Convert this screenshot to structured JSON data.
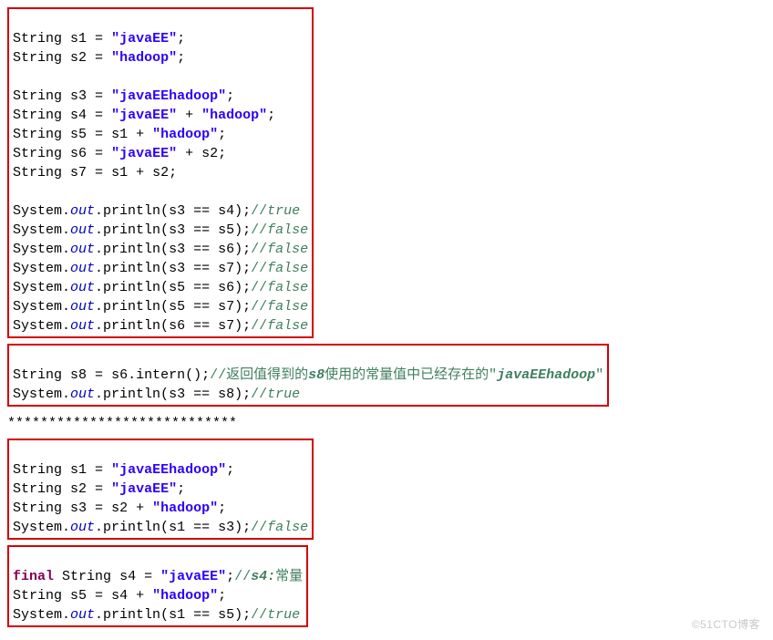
{
  "code": {
    "type": "String",
    "s1": "s1",
    "s2": "s2",
    "s3": "s3",
    "s4": "s4",
    "s5": "s5",
    "s6": "s6",
    "s7": "s7",
    "s8": "s8",
    "eq": " = ",
    "plus": " + ",
    "semi": ";",
    "eqeq": " == ",
    "sys": "System",
    "dot": ".",
    "out": "out",
    "println_open": ".println(",
    "close_paren": ")",
    "intern": ".intern()",
    "final": "final"
  },
  "strings": {
    "javaEE": "\"javaEE\"",
    "hadoop": "\"hadoop\"",
    "javaEEhadoop": "\"javaEEhadoop\""
  },
  "comments": {
    "true": "//",
    "true_txt": "true",
    "false": "//",
    "false_txt": "false",
    "intern_pre": "//返回值得到的",
    "intern_mid": "s8",
    "intern_post": "使用的常量值中已经存在的\"",
    "intern_str": "javaEEhadoop",
    "intern_end": "\"",
    "s4const_pre": "//",
    "s4const_mid": "s4:",
    "s4const_post": "常量"
  },
  "separator": "****************************",
  "watermark": "©51CTO博客"
}
